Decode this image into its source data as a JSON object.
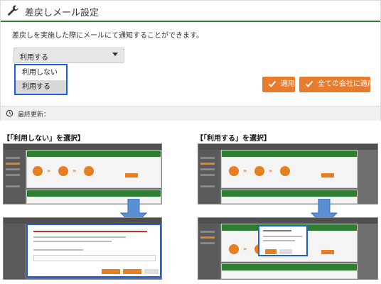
{
  "panel": {
    "title": "差戻しメール設定",
    "description": "差戻しを実施した際にメールにて通知することができます。",
    "select": {
      "value": "利用する",
      "options": [
        "利用しない",
        "利用する"
      ]
    },
    "apply_label": "適用",
    "apply_all_label": "全ての会社に適用",
    "history_label": "最終更新："
  },
  "captions": {
    "left": "【「利用しない」を選択】",
    "right": "【「利用する」を選択】"
  },
  "colors": {
    "accent_green": "#2e7d32",
    "button_orange": "#e87c2c",
    "highlight_blue": "#1e5fd6"
  },
  "icons": [
    "wrench-icon",
    "caret-down-icon",
    "check-icon",
    "history-icon",
    "down-arrow-icon"
  ]
}
